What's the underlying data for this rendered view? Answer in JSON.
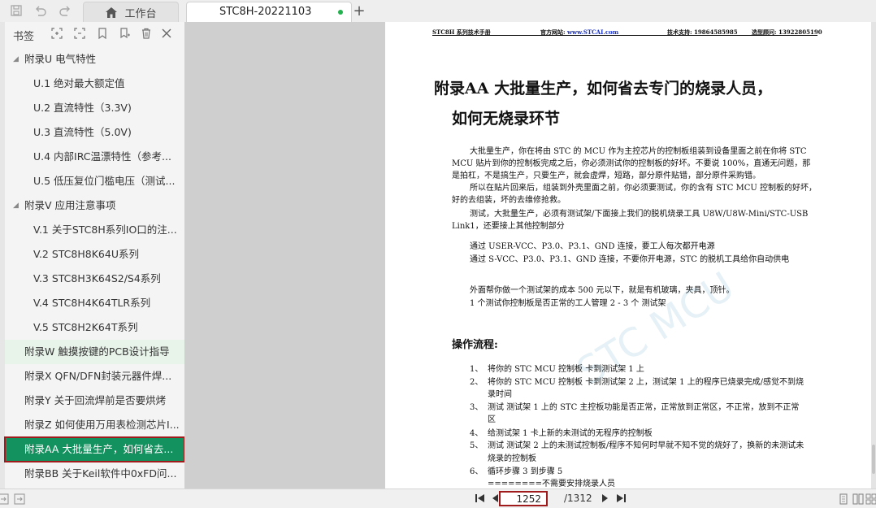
{
  "tabs": {
    "home_label": "工作台",
    "doc_label": "STC8H-20221103"
  },
  "sidebar": {
    "title": "书签",
    "items": [
      {
        "label": "附录U 电气特性",
        "level": 0,
        "caret": "◢"
      },
      {
        "label": "U.1 绝对最大额定值",
        "level": 1
      },
      {
        "label": "U.2 直流特性（3.3V)",
        "level": 1
      },
      {
        "label": "U.3 直流特性（5.0V)",
        "level": 1
      },
      {
        "label": "U.4 内部IRC温漂特性（参考...",
        "level": 1
      },
      {
        "label": "U.5 低压复位门槛电压（测试...",
        "level": 1
      },
      {
        "label": "附录V 应用注意事项",
        "level": 0,
        "caret": "◢"
      },
      {
        "label": "V.1 关于STC8H系列IO口的注...",
        "level": 1
      },
      {
        "label": "V.2 STC8H8K64U系列",
        "level": 1
      },
      {
        "label": "V.3 STC8H3K64S2/S4系列",
        "level": 1
      },
      {
        "label": "V.4 STC8H4K64TLR系列",
        "level": 1
      },
      {
        "label": "V.5 STC8H2K64T系列",
        "level": 1
      },
      {
        "label": "附录W 触摸按键的PCB设计指导",
        "level": 0,
        "state": "hover"
      },
      {
        "label": "附录X QFN/DFN封装元器件焊...",
        "level": 0
      },
      {
        "label": "附录Y 关于回流焊前是否要烘烤",
        "level": 0
      },
      {
        "label": "附录Z 如何使用万用表检测芯片I...",
        "level": 0
      },
      {
        "label": "附录AA 大批量生产，如何省去...",
        "level": 0,
        "state": "active"
      },
      {
        "label": "附录BB 关于Keil软件中0xFD问...",
        "level": 0
      }
    ]
  },
  "document": {
    "header": {
      "left": "STC8H 系列技术手册",
      "site_label": "官方网站: ",
      "site_link": "www.STCAI.com",
      "support": "技术支持: 19864585985",
      "consult": "选型顾问: 13922805190"
    },
    "heading_1": "附录AA 大批量生产，如何省去专门的烧录人员，",
    "heading_2": "如何无烧录环节",
    "lines": [
      "大批量生产，你在将由 STC 的 MCU 作为主控芯片的控制板组装到设备里面之前在你将 STC",
      "MCU 贴片到你的控制板完成之后，你必须测试你的控制板的好坏。不要说 100%，直通无问题，那",
      "是拍杠，不是搞生产，只要生产，就会虚焊，短路，部分原件贴错，部分原件采购错。",
      "所以在贴片回来后，组装到外壳里面之前，你必须要测试，你的含有 STC MCU 控制板的好坏，",
      "好的去组装，坏的去维修抢救。",
      "测试，大批量生产，必须有测试架/下面接上我们的脱机烧录工具 U8W/U8W-Mini/STC-USB",
      "Link1，还要接上其他控制部分",
      "通过 USER-VCC、P3.0、P3.1、GND 连接，要工人每次都开电源",
      "通过 S-VCC、P3.0、P3.1、GND 连接，不要你开电源，STC 的脱机工具给你自动供电",
      "外面帮你做一个测试架的成本 500 元以下，就是有机玻璃，夹具，顶针。",
      "1 个测试你控制板是否正常的工人管理 2 - 3 个 测试架"
    ],
    "watermark": "STC MCU",
    "section_title": "操作流程:",
    "steps": [
      {
        "num": "1、",
        "text": "将你的 STC MCU 控制板 卡到测试架 1 上"
      },
      {
        "num": "2、",
        "text": "将你的 STC MCU 控制板 卡到测试架 2 上，测试架 1 上的程序已烧录完成/感觉不到烧"
      },
      {
        "num": "",
        "text": "录时间"
      },
      {
        "num": "3、",
        "text": "测试 测试架 1 上的 STC 主控板功能是否正常，正常放到正常区，不正常，放到不正常"
      },
      {
        "num": "",
        "text": "区"
      },
      {
        "num": "4、",
        "text": "给测试架 1 卡上新的未测试的无程序的控制板"
      },
      {
        "num": "5、",
        "text": "测试 测试架 2 上的未测试控制板/程序不知何时早就不知不觉的烧好了，换新的未测试未"
      },
      {
        "num": "",
        "text": "烧录的控制板"
      },
      {
        "num": "6、",
        "text": "循环步骤 3 到步骤 5"
      },
      {
        "num": "",
        "text": "========不需要安排烧录人员"
      }
    ]
  },
  "pager": {
    "current_page": "1252",
    "total_pages": "/1312"
  },
  "colors": {
    "active_bookmark": "#13915f",
    "highlight_border": "#a01c1c",
    "modified_dot": "#22b14c"
  }
}
